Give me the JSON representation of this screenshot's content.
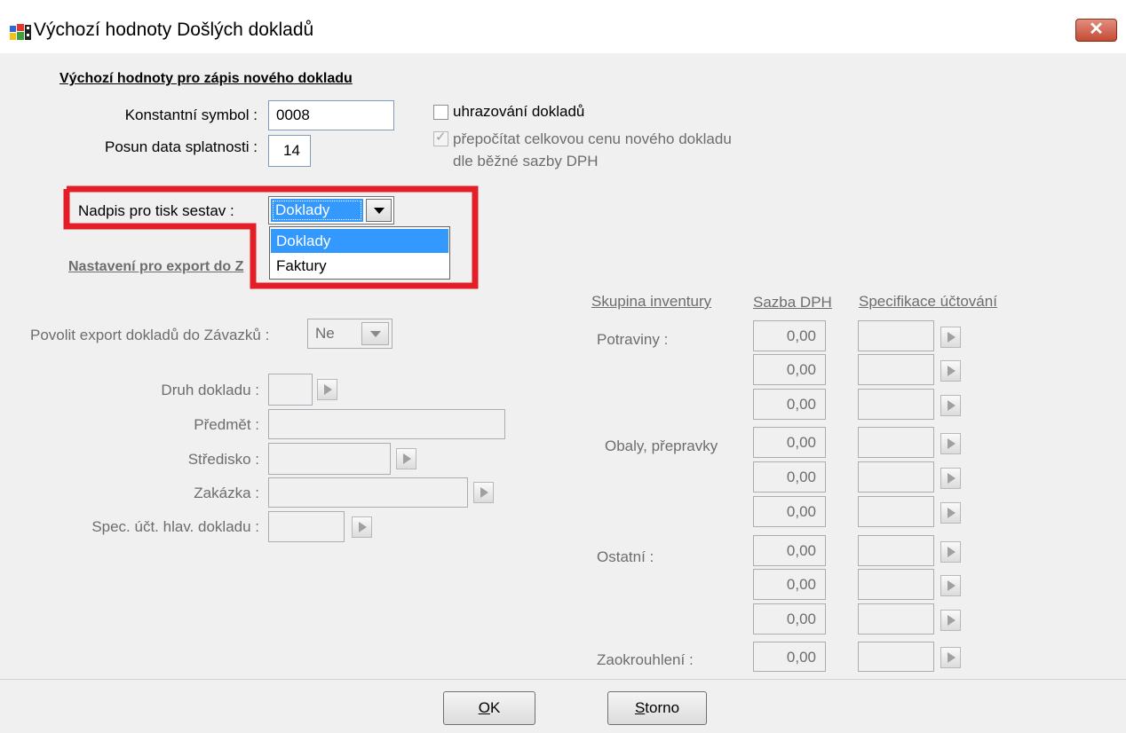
{
  "window": {
    "title": "Výchozí hodnoty Došlých dokladů",
    "close_label": "✕"
  },
  "new_document": {
    "heading": "Výchozí hodnoty pro zápis nového dokladu",
    "konstantni_symbol_label": "Konstantní symbol :",
    "konstantni_symbol_value": "0008",
    "posun_label": "Posun data splatnosti :",
    "posun_value": "14",
    "uhrazovani_label": "uhrazování dokladů",
    "uhrazovani_checked": false,
    "prepocitat_label_line1": "přepočítat celkovou cenu nového dokladu",
    "prepocitat_label_line2": "dle běžné sazby DPH",
    "prepocitat_checked": true,
    "nadpis_label": "Nadpis pro tisk sestav :",
    "nadpis_value": "Doklady",
    "nadpis_options": [
      "Doklady",
      "Faktury"
    ]
  },
  "export": {
    "heading": "Nastavení pro export do Z",
    "povolit_label": "Povolit export dokladů do Závazků :",
    "povolit_value": "Ne",
    "druh_label": "Druh dokladu :",
    "predmet_label": "Předmět :",
    "stredisko_label": "Středisko :",
    "zakazka_label": "Zakázka :",
    "spec_label": "Spec. účt. hlav. dokladu :"
  },
  "inventory": {
    "col_skupina": "Skupina inventury",
    "col_sazba": "Sazba DPH",
    "col_spec": "Specifikace účtování",
    "groups": [
      {
        "label": "Potraviny :",
        "rates": [
          "0,00",
          "0,00",
          "0,00"
        ]
      },
      {
        "label": "Obaly, přepravky",
        "rates": [
          "0,00",
          "0,00",
          "0,00"
        ]
      },
      {
        "label": "Ostatní :",
        "rates": [
          "0,00",
          "0,00",
          "0,00"
        ]
      }
    ],
    "zaokrouhleni_label": "Zaokrouhlení :",
    "zaokrouhleni_value": "0,00"
  },
  "buttons": {
    "ok_mnemonic": "O",
    "ok_rest": "K",
    "storno_mnemonic": "S",
    "storno_rest": "torno"
  },
  "colors": {
    "highlight": "#e41e26",
    "selection": "#3399ff"
  }
}
